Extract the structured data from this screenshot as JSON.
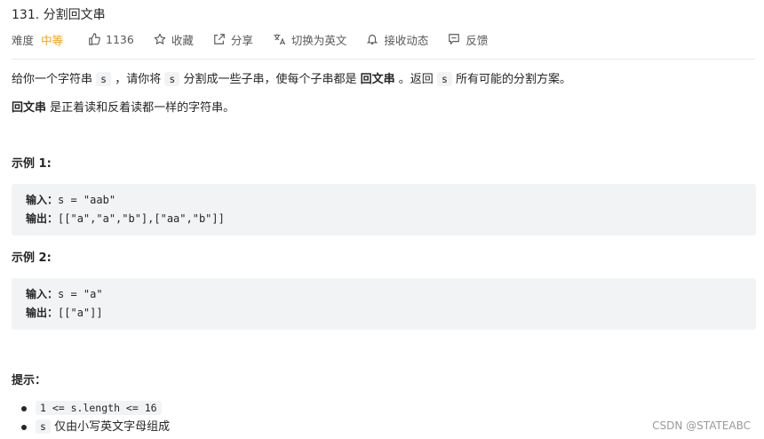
{
  "problem": {
    "title": "131. 分割回文串"
  },
  "meta": {
    "difficulty_label": "难度",
    "difficulty_value": "中等",
    "likes": "1136",
    "favorite": "收藏",
    "share": "分享",
    "switch_lang": "切换为英文",
    "subscribe": "接收动态",
    "feedback": "反馈",
    "accent_color": "#ffa116",
    "icons": [
      "thumb-up-icon",
      "star-icon",
      "share-icon",
      "translate-icon",
      "bell-icon",
      "feedback-icon"
    ]
  },
  "description": {
    "p1": {
      "a": "给你一个字符串",
      "code1": "s",
      "b": "，请你将",
      "code2": "s",
      "c": "分割成一些子串，使每个子串都是",
      "bold": "回文串",
      "d": "。返回",
      "code3": "s",
      "e": "所有可能的分割方案。"
    },
    "p2": {
      "bold": "回文串",
      "rest": "是正着读和反着读都一样的字符串。"
    }
  },
  "examples": [
    {
      "heading": "示例 1:",
      "input_label": "输入：",
      "input": "s = \"aab\"",
      "output_label": "输出：",
      "output": "[[\"a\",\"a\",\"b\"],[\"aa\",\"b\"]]"
    },
    {
      "heading": "示例 2:",
      "input_label": "输入：",
      "input": "s = \"a\"",
      "output_label": "输出：",
      "output": "[[\"a\"]]"
    }
  ],
  "hints": {
    "heading": "提示：",
    "items": [
      {
        "code": "1 <= s.length <= 16",
        "text": ""
      },
      {
        "code": "s",
        "text": "仅由小写英文字母组成"
      }
    ]
  },
  "watermark": "CSDN @STATEABC"
}
